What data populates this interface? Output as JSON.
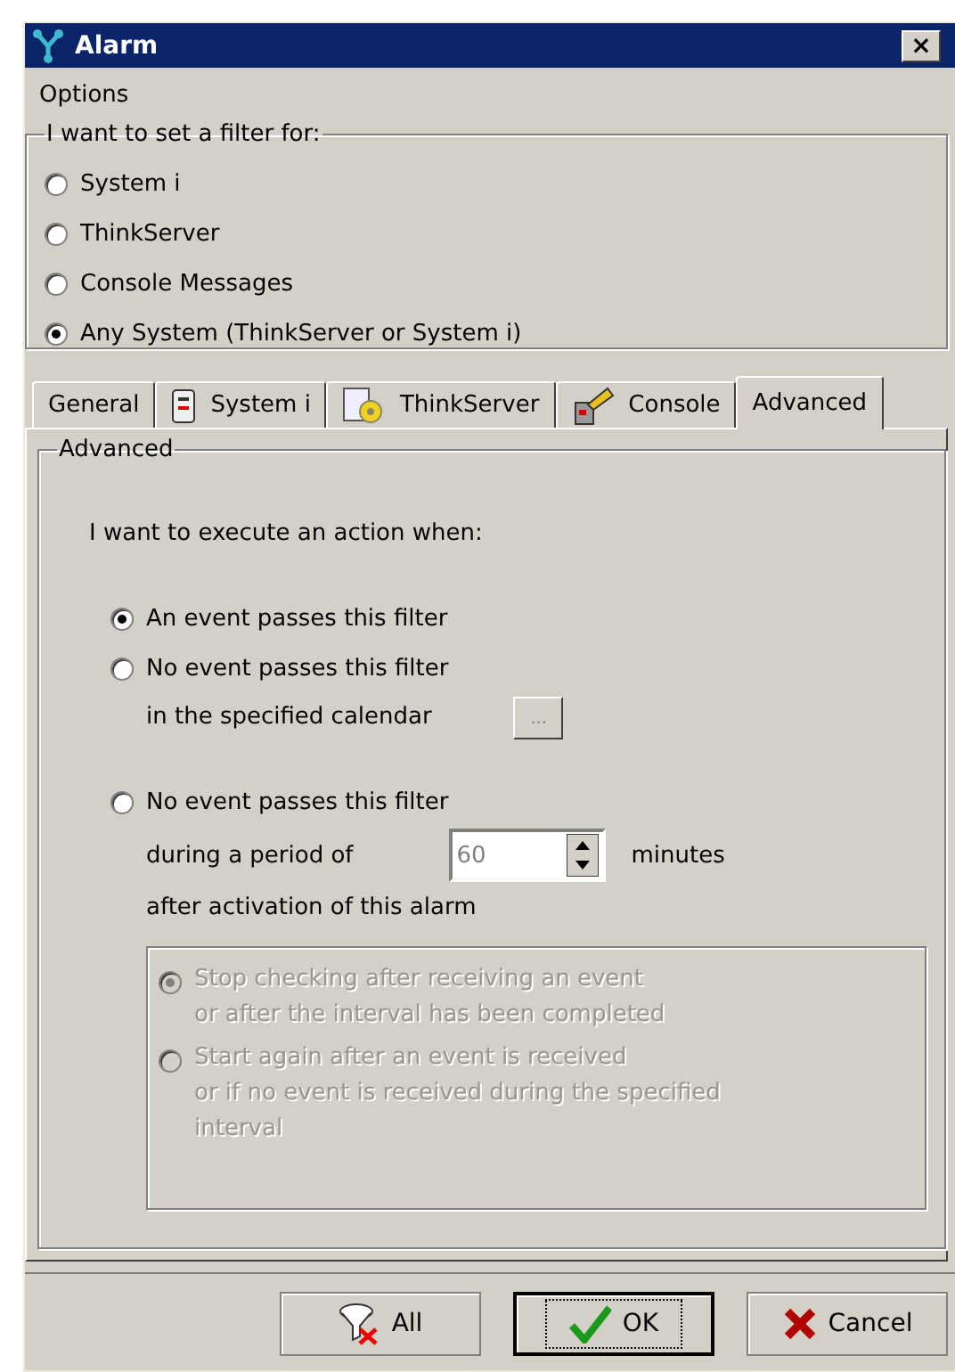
{
  "window": {
    "title": "Alarm",
    "close": "×"
  },
  "menu": [
    "Options"
  ],
  "filter_group": {
    "legend": "I want to set a filter for:",
    "options": [
      {
        "label": "System i",
        "selected": false
      },
      {
        "label": "ThinkServer",
        "selected": false
      },
      {
        "label": "Console Messages",
        "selected": false
      },
      {
        "label": "Any System (ThinkServer or System i)",
        "selected": true
      }
    ]
  },
  "tabs": [
    {
      "label": "General",
      "kind": "plain",
      "selected": false
    },
    {
      "label": "System i",
      "kind": "server",
      "selected": false
    },
    {
      "label": "ThinkServer",
      "kind": "gear",
      "selected": false
    },
    {
      "label": "Console",
      "kind": "console",
      "selected": false
    },
    {
      "label": "Advanced",
      "kind": "plain",
      "selected": true
    }
  ],
  "panel": {
    "legend": "Advanced",
    "prompt": "I want to execute an action when:",
    "options": [
      {
        "kind": "simple",
        "label": "An event passes this filter",
        "selected": true
      },
      {
        "kind": "calendar",
        "label": "No event passes this filter",
        "detail": "in the specified calendar",
        "button": "...",
        "selected": false
      },
      {
        "kind": "period",
        "label": "No event passes this filter",
        "detail": "during a period of",
        "value": "60",
        "unit": "minutes",
        "after": "after activation of this alarm",
        "selected": false
      }
    ],
    "sub_group": {
      "disabled": true,
      "options": [
        {
          "lines": [
            "Stop checking after receiving an event",
            "or after the interval has been completed"
          ],
          "selected": true
        },
        {
          "lines": [
            "Start again after an event is received",
            "or if no event is received during the specified",
            "interval"
          ],
          "selected": false
        }
      ]
    }
  },
  "buttons": [
    {
      "kind": "all",
      "label": "All",
      "default": false
    },
    {
      "kind": "ok",
      "label": "OK",
      "default": true
    },
    {
      "kind": "cancel",
      "label": "Cancel",
      "default": false
    }
  ]
}
